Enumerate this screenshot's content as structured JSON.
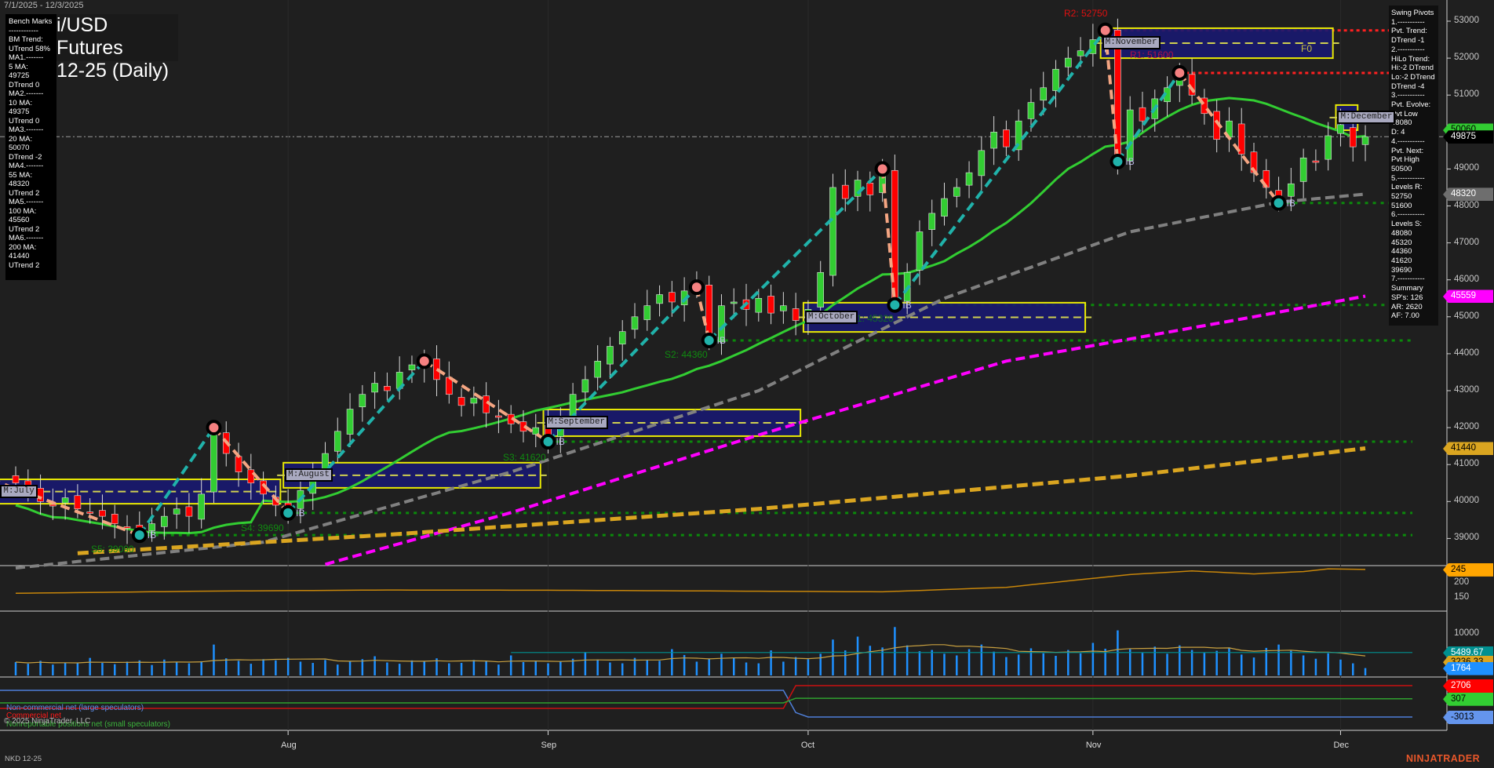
{
  "header": {
    "date_range": "7/1/2025 - 12/3/2025",
    "title_line1": "i/USD Futures",
    "title_line2": "12-25 (Daily)",
    "instrument": "NKD 12-25",
    "copyright": "© 2025 NinjaTrader, LLC",
    "brand": "NINJATRADER"
  },
  "bench_marks": {
    "lines": [
      "Bench Marks",
      "------------",
      "BM Trend:",
      "UTrend 58%",
      "MA1.-------",
      "5 MA:",
      "49725",
      "DTrend 0",
      "MA2.-------",
      "10 MA:",
      "49375",
      "UTrend 0",
      "MA3.-------",
      "20 MA:",
      "50070",
      "DTrend -2",
      "MA4.-------",
      "55 MA:",
      "48320",
      "UTrend 2",
      "MA5.-------",
      "100 MA:",
      "45560",
      "UTrend 2",
      "MA6.-------",
      "200 MA:",
      "41440",
      "UTrend 2"
    ]
  },
  "swing_pivots": {
    "lines": [
      "Swing Pivots",
      "1.-----------",
      "Pvt. Trend:",
      "DTrend -1",
      "2.-----------",
      "HiLo Trend:",
      "Hi:-2 DTrend",
      "Lo:-2 DTrend",
      "DTrend -4",
      "3.-----------",
      "Pvt. Evolve:",
      "Pvt Low",
      "48080",
      "D: 4",
      "4.-----------",
      "Pvt. Next:",
      "Pvt High",
      "50500",
      "5.-----------",
      "Levels R:",
      "52750",
      "51600",
      "6.-----------",
      "Levels S:",
      "48080",
      "45320",
      "44360",
      "41620",
      "39690",
      "7.-----------",
      "Summary",
      "SP's: 126",
      "AR: 2620",
      "AF: 7.00"
    ]
  },
  "price_axis": {
    "ticks": [
      "53000",
      "52000",
      "51000",
      "50000",
      "49000",
      "48000",
      "47000",
      "46000",
      "45000",
      "44000",
      "43000",
      "42000",
      "41000",
      "40000",
      "39000"
    ],
    "tags": [
      {
        "label": "50060",
        "bg": "#32cd32",
        "fg": "#000",
        "value": 50060
      },
      {
        "label": "49875",
        "bg": "#000000",
        "fg": "#fff",
        "value": 49875
      },
      {
        "label": "48320",
        "bg": "#6e6e6e",
        "fg": "#fff",
        "value": 48320
      },
      {
        "label": "45559",
        "bg": "#ff00ff",
        "fg": "#fff",
        "value": 45559
      },
      {
        "label": "41440",
        "bg": "#daa520",
        "fg": "#000",
        "value": 41440
      }
    ]
  },
  "indicator_axis": {
    "ticks": [
      "200",
      "150"
    ],
    "tag": {
      "label": "245",
      "bg": "#ffa500",
      "fg": "#000"
    }
  },
  "volume_axis": {
    "ticks": [
      "10000"
    ],
    "tags": [
      {
        "label": "5489.67",
        "bg": "#009090",
        "fg": "#fff"
      },
      {
        "label": "3236.33",
        "bg": "#daa520",
        "fg": "#000"
      },
      {
        "label": "1764",
        "bg": "#1e90ff",
        "fg": "#fff"
      }
    ]
  },
  "cot_axis": {
    "tags": [
      {
        "label": "2706",
        "bg": "#ff0000",
        "fg": "#fff"
      },
      {
        "label": "307",
        "bg": "#32cd32",
        "fg": "#000"
      },
      {
        "label": "-3013",
        "bg": "#6495ed",
        "fg": "#000"
      }
    ]
  },
  "cot_legend": {
    "noncommercial": "Non-commercial net (large speculators)",
    "commercial": "Commercial net",
    "nonreportable": "Nonreportable positions net (small speculators)"
  },
  "time_axis": {
    "labels": [
      "Aug",
      "Sep",
      "Oct",
      "Nov",
      "Dec"
    ]
  },
  "monthly_zones": [
    {
      "label": "M:July",
      "start": -1,
      "end": 21,
      "top": 40600,
      "bottom": 39940
    },
    {
      "label": "M:August",
      "start": 22,
      "end": 42,
      "top": 41050,
      "bottom": 40370
    },
    {
      "label": "M:September",
      "start": 43,
      "end": 63,
      "top": 42490,
      "bottom": 41770
    },
    {
      "label": "M:October",
      "start": 64,
      "end": 86,
      "top": 45380,
      "bottom": 44590
    },
    {
      "label": "M:November",
      "start": 88,
      "end": 106,
      "top": 52810,
      "bottom": 52000
    },
    {
      "label": "M:December",
      "start": 107,
      "end": 108,
      "top": 50730,
      "bottom": 50050
    }
  ],
  "levels": {
    "R2": {
      "label": "R2: 52750",
      "value": 52750
    },
    "R1": {
      "label": "R1: 51600",
      "value": 51600
    },
    "S1": {
      "label": "S1: 45320",
      "value": 45320
    },
    "S2": {
      "label": "S2: 44360",
      "value": 44360
    },
    "S3": {
      "label": "S3: 41620",
      "value": 41620
    },
    "S4": {
      "label": "S4: 39690",
      "value": 39690
    },
    "S5": {
      "label": "S5: 39090",
      "value": 39090
    },
    "pivot_low": {
      "value": 48080
    },
    "ib_label": "IB",
    "f0_label": "F0"
  },
  "colors": {
    "up": "#32cd32",
    "down": "#ff0000",
    "ma20": "#32cd32",
    "ma55": "#808080",
    "ma100": "#ff00ff",
    "ma200": "#daa520",
    "swing_up": "#20b2aa",
    "swing_down": "#f4a582",
    "zone": "#191970",
    "zone_border": "#ffff00"
  },
  "chart_data": {
    "type": "candlestick",
    "title": "i/USD Futures 12-25 (Daily)",
    "ylim": [
      38500,
      53300
    ],
    "closes": [
      40500,
      40300,
      40000,
      39900,
      40100,
      39800,
      39700,
      39600,
      39400,
      39300,
      39150,
      39400,
      39600,
      39800,
      39600,
      40200,
      41800,
      41300,
      40800,
      40500,
      40200,
      39900,
      39750,
      40300,
      40800,
      41300,
      41900,
      42500,
      42900,
      43200,
      43000,
      43500,
      43700,
      43800,
      43300,
      42900,
      42600,
      42800,
      42400,
      42300,
      42100,
      41900,
      42000,
      41700,
      42300,
      42900,
      43300,
      43800,
      44200,
      44600,
      45000,
      45300,
      45600,
      45400,
      45700,
      45800,
      44400,
      45300,
      45400,
      45200,
      45500,
      45100,
      45300,
      44900,
      45200,
      46200,
      48500,
      48200,
      48700,
      48300,
      48900,
      45500,
      46200,
      47300,
      47800,
      48200,
      48500,
      48900,
      49500,
      50000,
      49600,
      50300,
      50800,
      51200,
      51700,
      52000,
      52200,
      52500,
      52700,
      49300,
      50600,
      50300,
      50900,
      51200,
      51500,
      51000,
      50500,
      49800,
      50300,
      49400,
      48900,
      48500,
      48200,
      48600,
      49300,
      49200,
      49900,
      50200,
      49600,
      49875
    ],
    "swing_pivots": [
      [
        -2,
        40600
      ],
      [
        10,
        39090
      ],
      [
        16,
        42000
      ],
      [
        22,
        39690
      ],
      [
        33,
        43800
      ],
      [
        43,
        41620
      ],
      [
        55,
        45800
      ],
      [
        56,
        44360
      ],
      [
        70,
        49000
      ],
      [
        71,
        45320
      ],
      [
        88,
        52750
      ],
      [
        89,
        49200
      ],
      [
        94,
        51600
      ],
      [
        102,
        48080
      ]
    ],
    "ma55": [
      [
        0,
        38200
      ],
      [
        20,
        38900
      ],
      [
        40,
        40800
      ],
      [
        60,
        43000
      ],
      [
        75,
        45500
      ],
      [
        90,
        47300
      ],
      [
        102,
        48100
      ],
      [
        109,
        48320
      ]
    ],
    "ma100": [
      [
        25,
        38300
      ],
      [
        40,
        39700
      ],
      [
        60,
        41800
      ],
      [
        80,
        43800
      ],
      [
        100,
        45000
      ],
      [
        109,
        45559
      ]
    ],
    "ma200": [
      [
        5,
        38600
      ],
      [
        30,
        39100
      ],
      [
        60,
        39800
      ],
      [
        90,
        40700
      ],
      [
        109,
        41440
      ]
    ],
    "indicator": [
      [
        0,
        165
      ],
      [
        15,
        172
      ],
      [
        30,
        176
      ],
      [
        45,
        175
      ],
      [
        60,
        172
      ],
      [
        70,
        170
      ],
      [
        80,
        185
      ],
      [
        90,
        228
      ],
      [
        95,
        240
      ],
      [
        100,
        230
      ],
      [
        104,
        238
      ],
      [
        106,
        247
      ],
      [
        109,
        245
      ]
    ],
    "volume": [
      3200,
      2800,
      3500,
      2600,
      3100,
      2900,
      4200,
      3000,
      2700,
      3300,
      3600,
      2500,
      3800,
      3100,
      2900,
      3400,
      7400,
      4100,
      3500,
      2800,
      3900,
      3600,
      4200,
      3300,
      3000,
      3700,
      2600,
      3400,
      3900,
      4600,
      3100,
      2800,
      3600,
      3300,
      4100,
      2900,
      3000,
      3700,
      3400,
      2600,
      4800,
      3200,
      3500,
      2900,
      3400,
      4000,
      5600,
      3800,
      3100,
      2900,
      4200,
      3700,
      3500,
      6300,
      4900,
      3300,
      3900,
      5200,
      4200,
      3100,
      2900,
      6000,
      3300,
      4400,
      3900,
      5200,
      8600,
      6000,
      9300,
      7100,
      6700,
      11600,
      7200,
      5800,
      6100,
      5200,
      4800,
      6300,
      7400,
      5700,
      4400,
      5000,
      6500,
      5300,
      4700,
      6100,
      5300,
      7800,
      6400,
      10800,
      6300,
      5400,
      6900,
      5200,
      7200,
      6100,
      5400,
      5900,
      6700,
      5000,
      4300,
      6600,
      7400,
      5900,
      4800,
      4000,
      5300,
      3800,
      2900,
      1764
    ],
    "cot": {
      "noncommercial": [
        [
          0,
          1850
        ],
        [
          62,
          1850
        ],
        [
          63,
          -2200
        ],
        [
          64,
          -3013
        ],
        [
          109,
          -3013
        ]
      ],
      "commercial": [
        [
          0,
          -1440
        ],
        [
          62,
          -1440
        ],
        [
          63,
          2706
        ],
        [
          109,
          2706
        ]
      ],
      "nonreportable": [
        [
          0,
          -440
        ],
        [
          62,
          -440
        ],
        [
          63,
          400
        ],
        [
          109,
          307
        ]
      ]
    }
  }
}
